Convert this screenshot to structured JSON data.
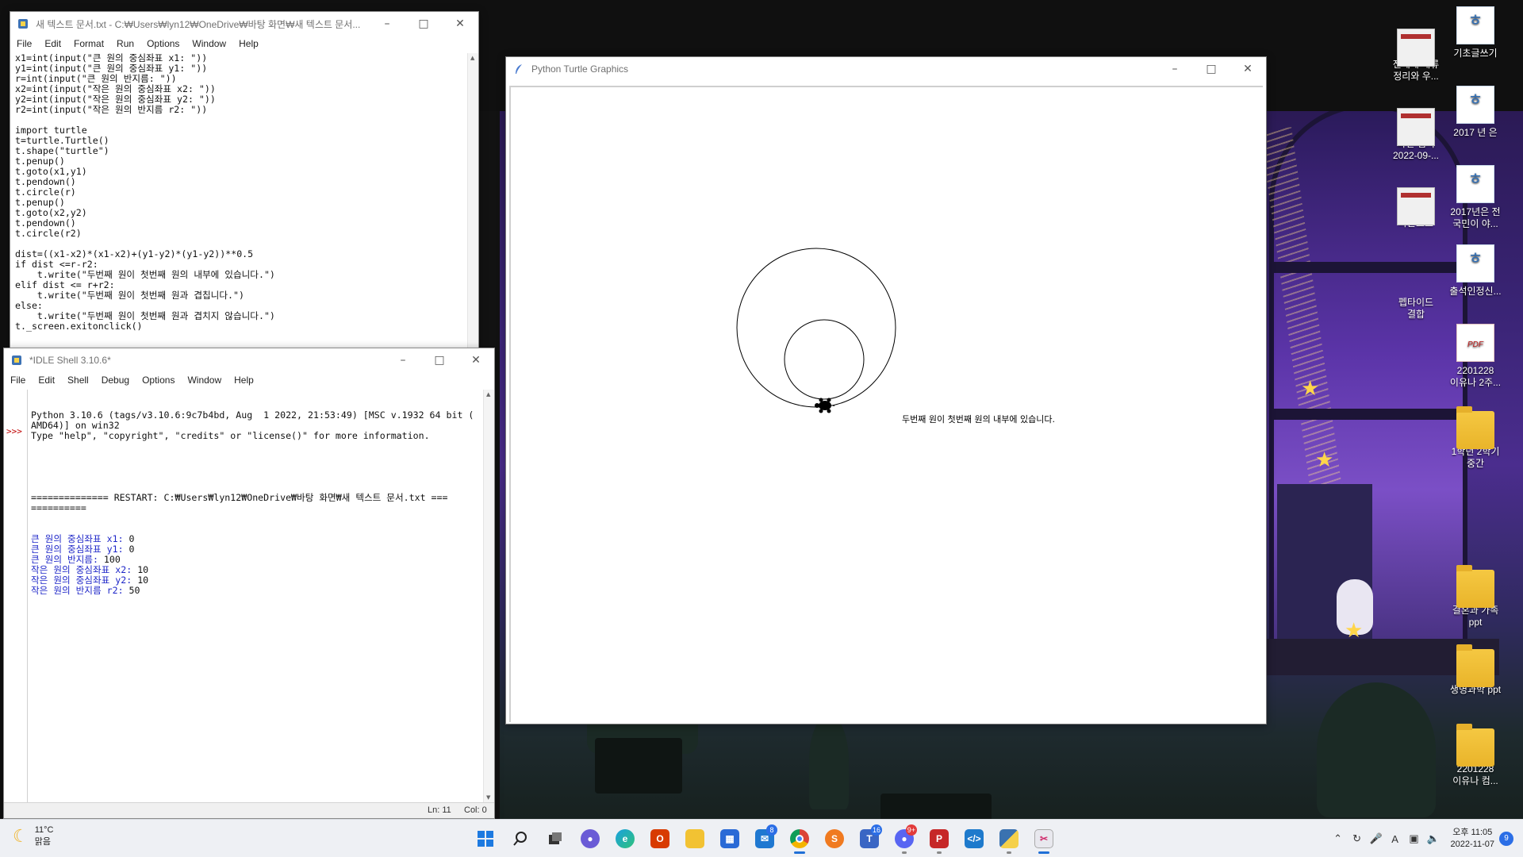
{
  "editor": {
    "title": "새 텍스트 문서.txt - C:₩Users₩lyn12₩OneDrive₩바탕 화면₩새 텍스트 문서...",
    "menu": [
      "File",
      "Edit",
      "Format",
      "Run",
      "Options",
      "Window",
      "Help"
    ],
    "code": "x1=int(input(\"큰 원의 중심좌표 x1: \"))\ny1=int(input(\"큰 원의 중심좌표 y1: \"))\nr=int(input(\"큰 원의 반지름: \"))\nx2=int(input(\"작은 원의 중심좌표 x2: \"))\ny2=int(input(\"작은 원의 중심좌표 y2: \"))\nr2=int(input(\"작은 원의 반지름 r2: \"))\n\nimport turtle\nt=turtle.Turtle()\nt.shape(\"turtle\")\nt.penup()\nt.goto(x1,y1)\nt.pendown()\nt.circle(r)\nt.penup()\nt.goto(x2,y2)\nt.pendown()\nt.circle(r2)\n\ndist=((x1-x2)*(x1-x2)+(y1-y2)*(y1-y2))**0.5\nif dist <=r-r2:\n    t.write(\"두번째 원이 첫번째 원의 내부에 있습니다.\")\nelif dist <= r+r2:\n    t.write(\"두번째 원이 첫번째 원과 겹칩니다.\")\nelse:\n    t.write(\"두번째 원이 첫번째 원과 겹치지 않습니다.\")\nt._screen.exitonclick()"
  },
  "shell": {
    "title": "*IDLE Shell 3.10.6*",
    "menu": [
      "File",
      "Edit",
      "Shell",
      "Debug",
      "Options",
      "Window",
      "Help"
    ],
    "prompt": ">>>",
    "banner": "Python 3.10.6 (tags/v3.10.6:9c7b4bd, Aug  1 2022, 21:53:49) [MSC v.1932 64 bit (\nAMD64)] on win32\nType \"help\", \"copyright\", \"credits\" or \"license()\" for more information.",
    "restart": "============== RESTART: C:₩Users₩lyn12₩OneDrive₩바탕 화면₩새 텍스트 문서.txt ===\n==========",
    "io": [
      {
        "prompt": "큰 원의 중심좌표 x1: ",
        "value": "0"
      },
      {
        "prompt": "큰 원의 중심좌표 y1: ",
        "value": "0"
      },
      {
        "prompt": "큰 원의 반지름: ",
        "value": "100"
      },
      {
        "prompt": "작은 원의 중심좌표 x2: ",
        "value": "10"
      },
      {
        "prompt": "작은 원의 중심좌표 y2: ",
        "value": "10"
      },
      {
        "prompt": "작은 원의 반지름 r2: ",
        "value": "50"
      }
    ],
    "status_ln": "Ln: 11",
    "status_col": "Col: 0"
  },
  "turtle": {
    "title": "Python Turtle Graphics",
    "output_text": "두번째 원이 첫번째 원의 내부에 있습니다."
  },
  "desktop_icons": [
    {
      "label": "전세계 해류\n정리와 우...",
      "kind": "shot"
    },
    {
      "label": "기초글쓰기",
      "kind": "hwp"
    },
    {
      "label": "화면 캡처\n2022-09-...",
      "kind": "shot"
    },
    {
      "label": "2017 년 은",
      "kind": "hwp"
    },
    {
      "label": "다운로드",
      "kind": "shot"
    },
    {
      "label": "2017년은 전\n국민이 야...",
      "kind": "hwp"
    },
    {
      "label": "펩타이드\n결합",
      "kind": "none"
    },
    {
      "label": "출석인정신...",
      "kind": "hwp"
    },
    {
      "label": "2201228\n이유나 2주...",
      "kind": "pdf"
    },
    {
      "label": "1학년 2학기\n중간",
      "kind": "folder"
    },
    {
      "label": "결혼과 가족\nppt",
      "kind": "folder"
    },
    {
      "label": "생명과학 ppt",
      "kind": "folder"
    },
    {
      "label": "2201228\n이유나 컴...",
      "kind": "folder"
    }
  ],
  "taskbar": {
    "weather_temp": "11°C",
    "weather_desc": "맑음",
    "badges": {
      "mail": "8",
      "teams": "16",
      "discord": "9+"
    },
    "clock_time": "오후 11:05",
    "clock_date": "2022-11-07",
    "ime": "A",
    "notification_count": "9"
  }
}
